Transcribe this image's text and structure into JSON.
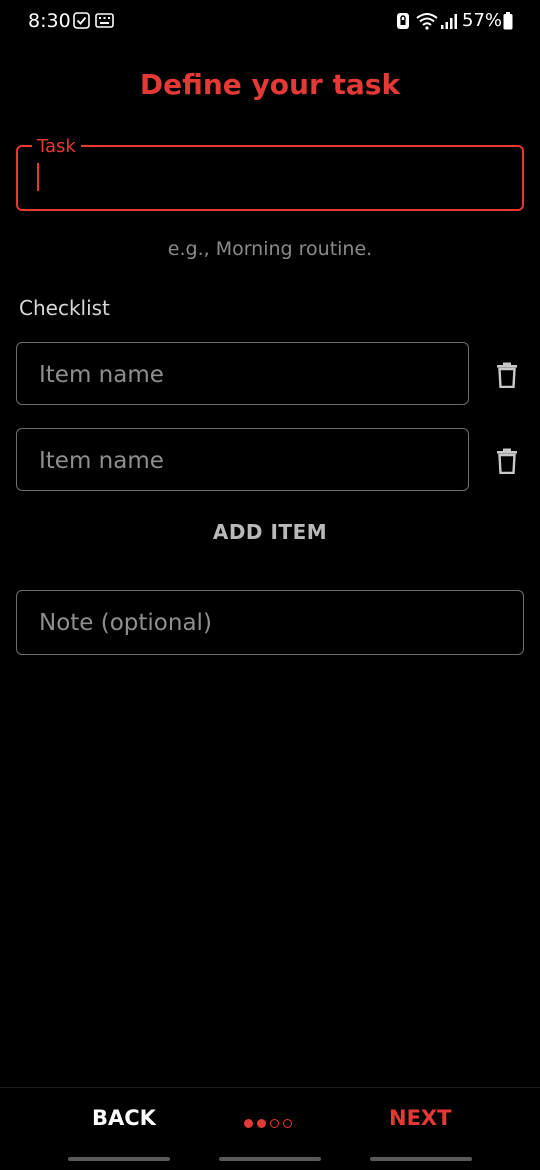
{
  "status_bar": {
    "time": "8:30",
    "battery_text": "57%",
    "icons": [
      "check-box-icon",
      "keyboard-icon",
      "lock-icon",
      "wifi-icon",
      "signal-icon",
      "battery-icon"
    ]
  },
  "page": {
    "title": "Define your task"
  },
  "task": {
    "label": "Task",
    "value": "",
    "helper": "e.g., Morning routine."
  },
  "checklist": {
    "label": "Checklist",
    "items": [
      {
        "placeholder": "Item name",
        "value": ""
      },
      {
        "placeholder": "Item name",
        "value": ""
      }
    ],
    "add_label": "ADD ITEM"
  },
  "note": {
    "placeholder": "Note (optional)",
    "value": ""
  },
  "footer": {
    "back_label": "BACK",
    "next_label": "NEXT",
    "steps_total": 4,
    "steps_completed": 2
  },
  "colors": {
    "accent": "#e53935",
    "background": "#000000",
    "outline": "#6d6d6d"
  }
}
